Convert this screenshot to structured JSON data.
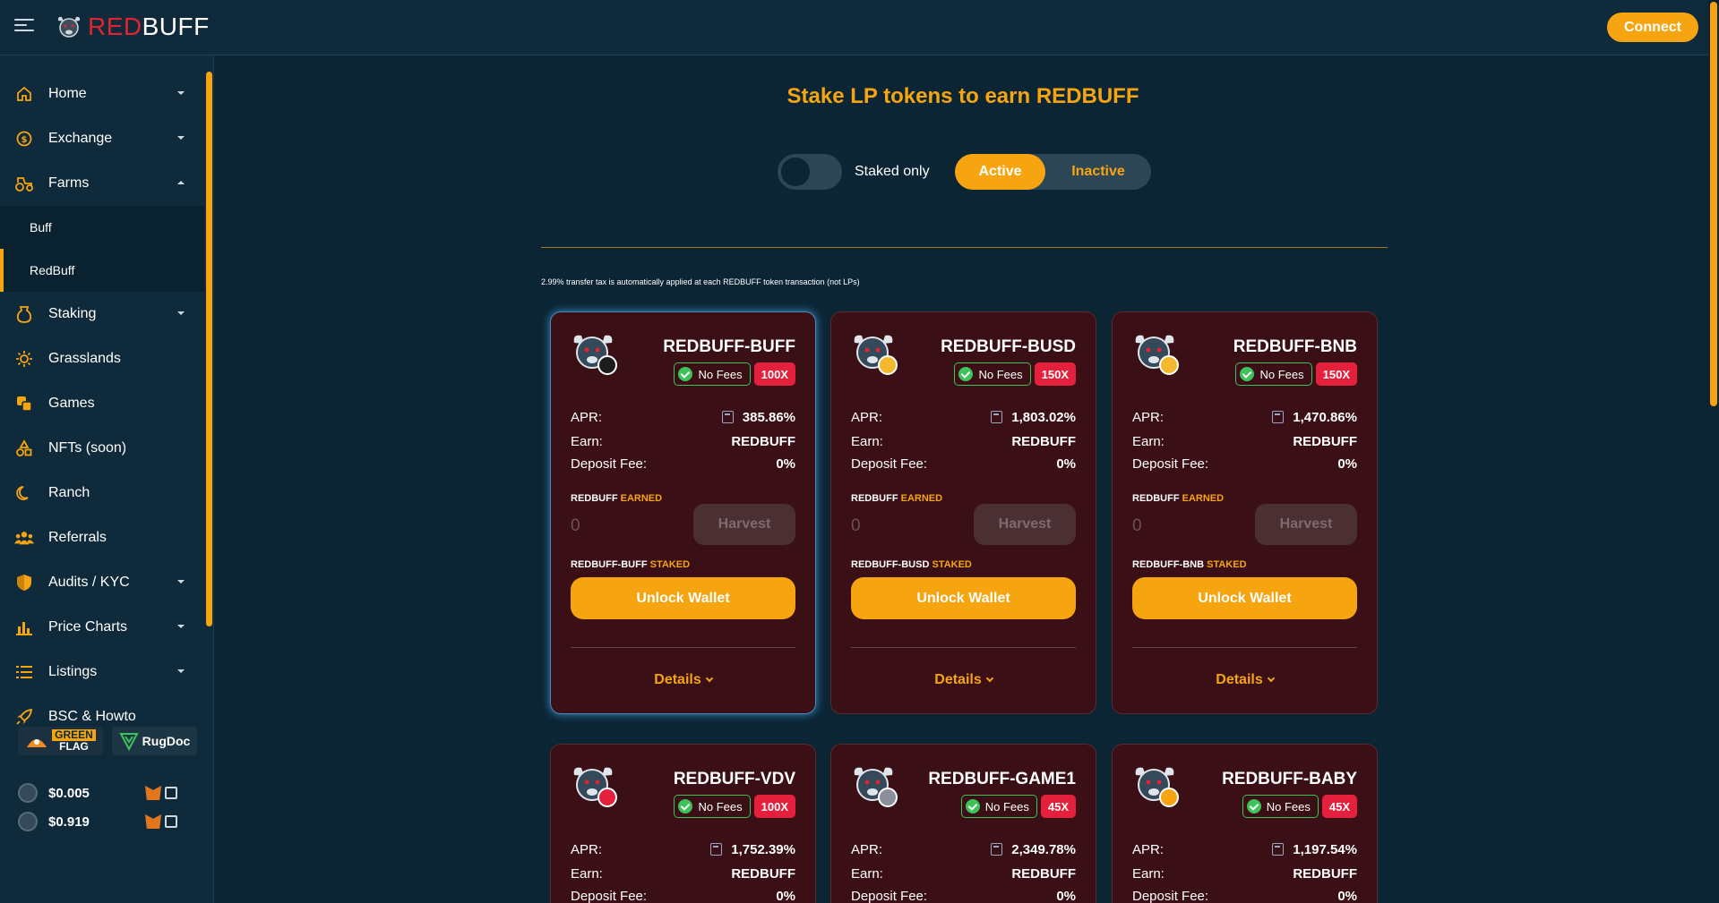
{
  "header": {
    "logo_red": "RED",
    "logo_white": "BUFF",
    "connect_label": "Connect"
  },
  "sidebar": {
    "items": [
      {
        "label": "Home",
        "icon": "home-icon"
      },
      {
        "label": "Exchange",
        "icon": "exchange-icon"
      },
      {
        "label": "Farms",
        "icon": "tractor-icon"
      },
      {
        "label": "Staking",
        "icon": "staking-icon"
      },
      {
        "label": "Grasslands",
        "icon": "sun-icon"
      },
      {
        "label": "Games",
        "icon": "dice-icon"
      },
      {
        "label": "NFTs (soon)",
        "icon": "shapes-icon"
      },
      {
        "label": "Ranch",
        "icon": "moon-icon"
      },
      {
        "label": "Referrals",
        "icon": "users-icon"
      },
      {
        "label": "Audits / KYC",
        "icon": "shield-icon"
      },
      {
        "label": "Price Charts",
        "icon": "bar-chart-icon"
      },
      {
        "label": "Listings",
        "icon": "list-icon"
      },
      {
        "label": "BSC & Howto",
        "icon": "rocket-icon"
      }
    ],
    "farms_sub": [
      {
        "label": "Buff"
      },
      {
        "label": "RedBuff"
      }
    ],
    "badges": {
      "greenflag_line1": "GREEN",
      "greenflag_line2": "FLAG",
      "rugdoc": "RugDoc"
    },
    "prices": [
      {
        "value": "$0.005"
      },
      {
        "value": "$0.919"
      }
    ]
  },
  "main": {
    "title": "Stake LP tokens to earn REDBUFF",
    "staked_only_label": "Staked only",
    "seg_active": "Active",
    "seg_inactive": "Inactive",
    "tax_note": "2.99% transfer tax is automatically applied at each REDBUFF token transaction (not LPs)"
  },
  "cards": [
    {
      "pair": "REDBUFF-BUFF",
      "nofees": "No Fees",
      "mult": "100X",
      "apr_label": "APR:",
      "apr": "385.86%",
      "earn_label": "Earn:",
      "earn": "REDBUFF",
      "fee_label": "Deposit Fee:",
      "fee": "0%",
      "earned_w": "REDBUFF",
      "earned_o": "EARNED",
      "earned_val": "0",
      "harvest": "Harvest",
      "staked_w": "REDBUFF-BUFF",
      "staked_o": "STAKED",
      "unlock": "Unlock Wallet",
      "details": "Details"
    },
    {
      "pair": "REDBUFF-BUSD",
      "nofees": "No Fees",
      "mult": "150X",
      "apr_label": "APR:",
      "apr": "1,803.02%",
      "earn_label": "Earn:",
      "earn": "REDBUFF",
      "fee_label": "Deposit Fee:",
      "fee": "0%",
      "earned_w": "REDBUFF",
      "earned_o": "EARNED",
      "earned_val": "0",
      "harvest": "Harvest",
      "staked_w": "REDBUFF-BUSD",
      "staked_o": "STAKED",
      "unlock": "Unlock Wallet",
      "details": "Details"
    },
    {
      "pair": "REDBUFF-BNB",
      "nofees": "No Fees",
      "mult": "150X",
      "apr_label": "APR:",
      "apr": "1,470.86%",
      "earn_label": "Earn:",
      "earn": "REDBUFF",
      "fee_label": "Deposit Fee:",
      "fee": "0%",
      "earned_w": "REDBUFF",
      "earned_o": "EARNED",
      "earned_val": "0",
      "harvest": "Harvest",
      "staked_w": "REDBUFF-BNB",
      "staked_o": "STAKED",
      "unlock": "Unlock Wallet",
      "details": "Details"
    },
    {
      "pair": "REDBUFF-VDV",
      "nofees": "No Fees",
      "mult": "100X",
      "apr_label": "APR:",
      "apr": "1,752.39%",
      "earn_label": "Earn:",
      "earn": "REDBUFF",
      "fee_label": "Deposit Fee:",
      "fee": "0%"
    },
    {
      "pair": "REDBUFF-GAME1",
      "nofees": "No Fees",
      "mult": "45X",
      "apr_label": "APR:",
      "apr": "2,349.78%",
      "earn_label": "Earn:",
      "earn": "REDBUFF",
      "fee_label": "Deposit Fee:",
      "fee": "0%"
    },
    {
      "pair": "REDBUFF-BABY",
      "nofees": "No Fees",
      "mult": "45X",
      "apr_label": "APR:",
      "apr": "1,197.54%",
      "earn_label": "Earn:",
      "earn": "REDBUFF",
      "fee_label": "Deposit Fee:",
      "fee": "0%"
    }
  ],
  "colors": {
    "accent": "#f6a511",
    "brand_red": "#e02432",
    "card_bg": "#3a0f15",
    "page_bg": "#0b2535"
  }
}
